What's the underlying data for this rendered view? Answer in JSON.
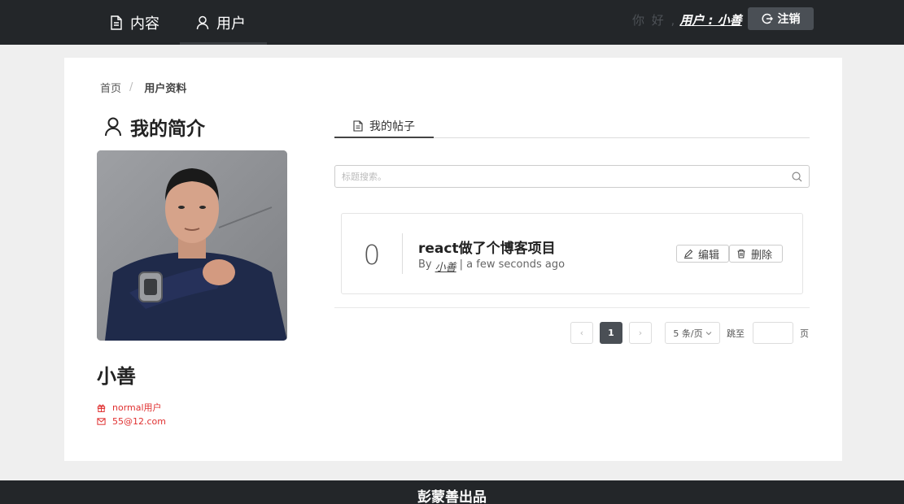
{
  "nav": {
    "items": [
      {
        "label": "内容",
        "icon": "file-text-icon"
      },
      {
        "label": "用户",
        "icon": "user-icon"
      }
    ],
    "greeting": "你 好 ,",
    "username": "用户 : 小善",
    "logout_label": "注销"
  },
  "breadcrumb": {
    "home": "首页",
    "separator": "/",
    "current": "用户资料"
  },
  "profile": {
    "title": "我的简介",
    "name": "小善",
    "role": "normal用户",
    "email": "55@12.com"
  },
  "tabs": [
    {
      "label": "我的帖子",
      "active": true
    }
  ],
  "search": {
    "placeholder": "标题搜索。"
  },
  "posts": [
    {
      "count": "0",
      "title": "react做了个博客项目",
      "by": "By",
      "author": "小善",
      "time": "| a few seconds ago",
      "edit_label": "编辑",
      "delete_label": "删除"
    }
  ],
  "pagination": {
    "prev": "‹",
    "current": "1",
    "next": "›",
    "page_size": "5 条/页",
    "jump_label": "跳至",
    "jump_value": "",
    "page_suffix": "页"
  },
  "footer": {
    "text": "彭蒙善出品"
  },
  "colors": {
    "nav_bg": "#232629",
    "accent_red": "#e03030",
    "active_page": "#4a4f55"
  }
}
